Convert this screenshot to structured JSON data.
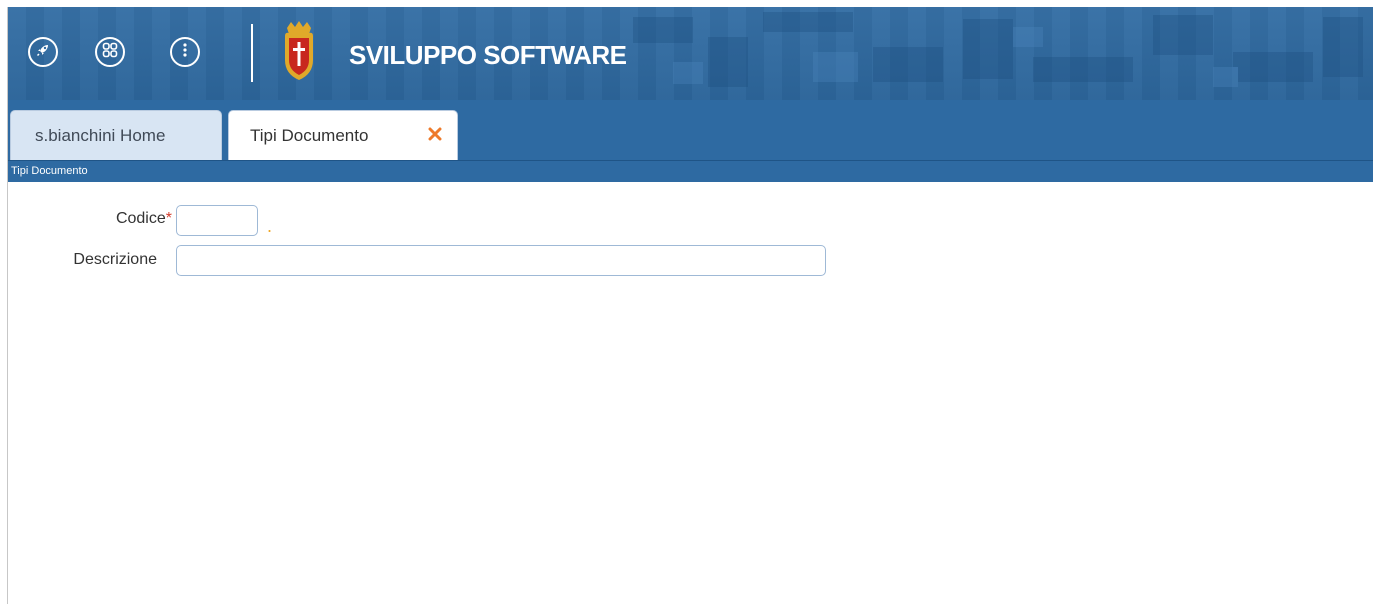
{
  "header": {
    "title": "SVILUPPO SOFTWARE",
    "icons": [
      "rocket-icon",
      "apps-grid-icon",
      "more-vertical-icon",
      "coat-of-arms-logo"
    ],
    "colors": {
      "brand_blue": "#2e6aa2",
      "accent_orange": "#f0a826",
      "required_red": "#d33b2c"
    }
  },
  "tabs": [
    {
      "label": "s.bianchini Home",
      "active": false
    },
    {
      "label": "Tipi Documento",
      "active": true,
      "closable": true
    }
  ],
  "section": {
    "title": "Tipi Documento"
  },
  "form": {
    "codice": {
      "label": "Codice",
      "required_mark": "*",
      "value": ""
    },
    "descrizione": {
      "label": "Descrizione",
      "value": ""
    },
    "indicator": "."
  }
}
